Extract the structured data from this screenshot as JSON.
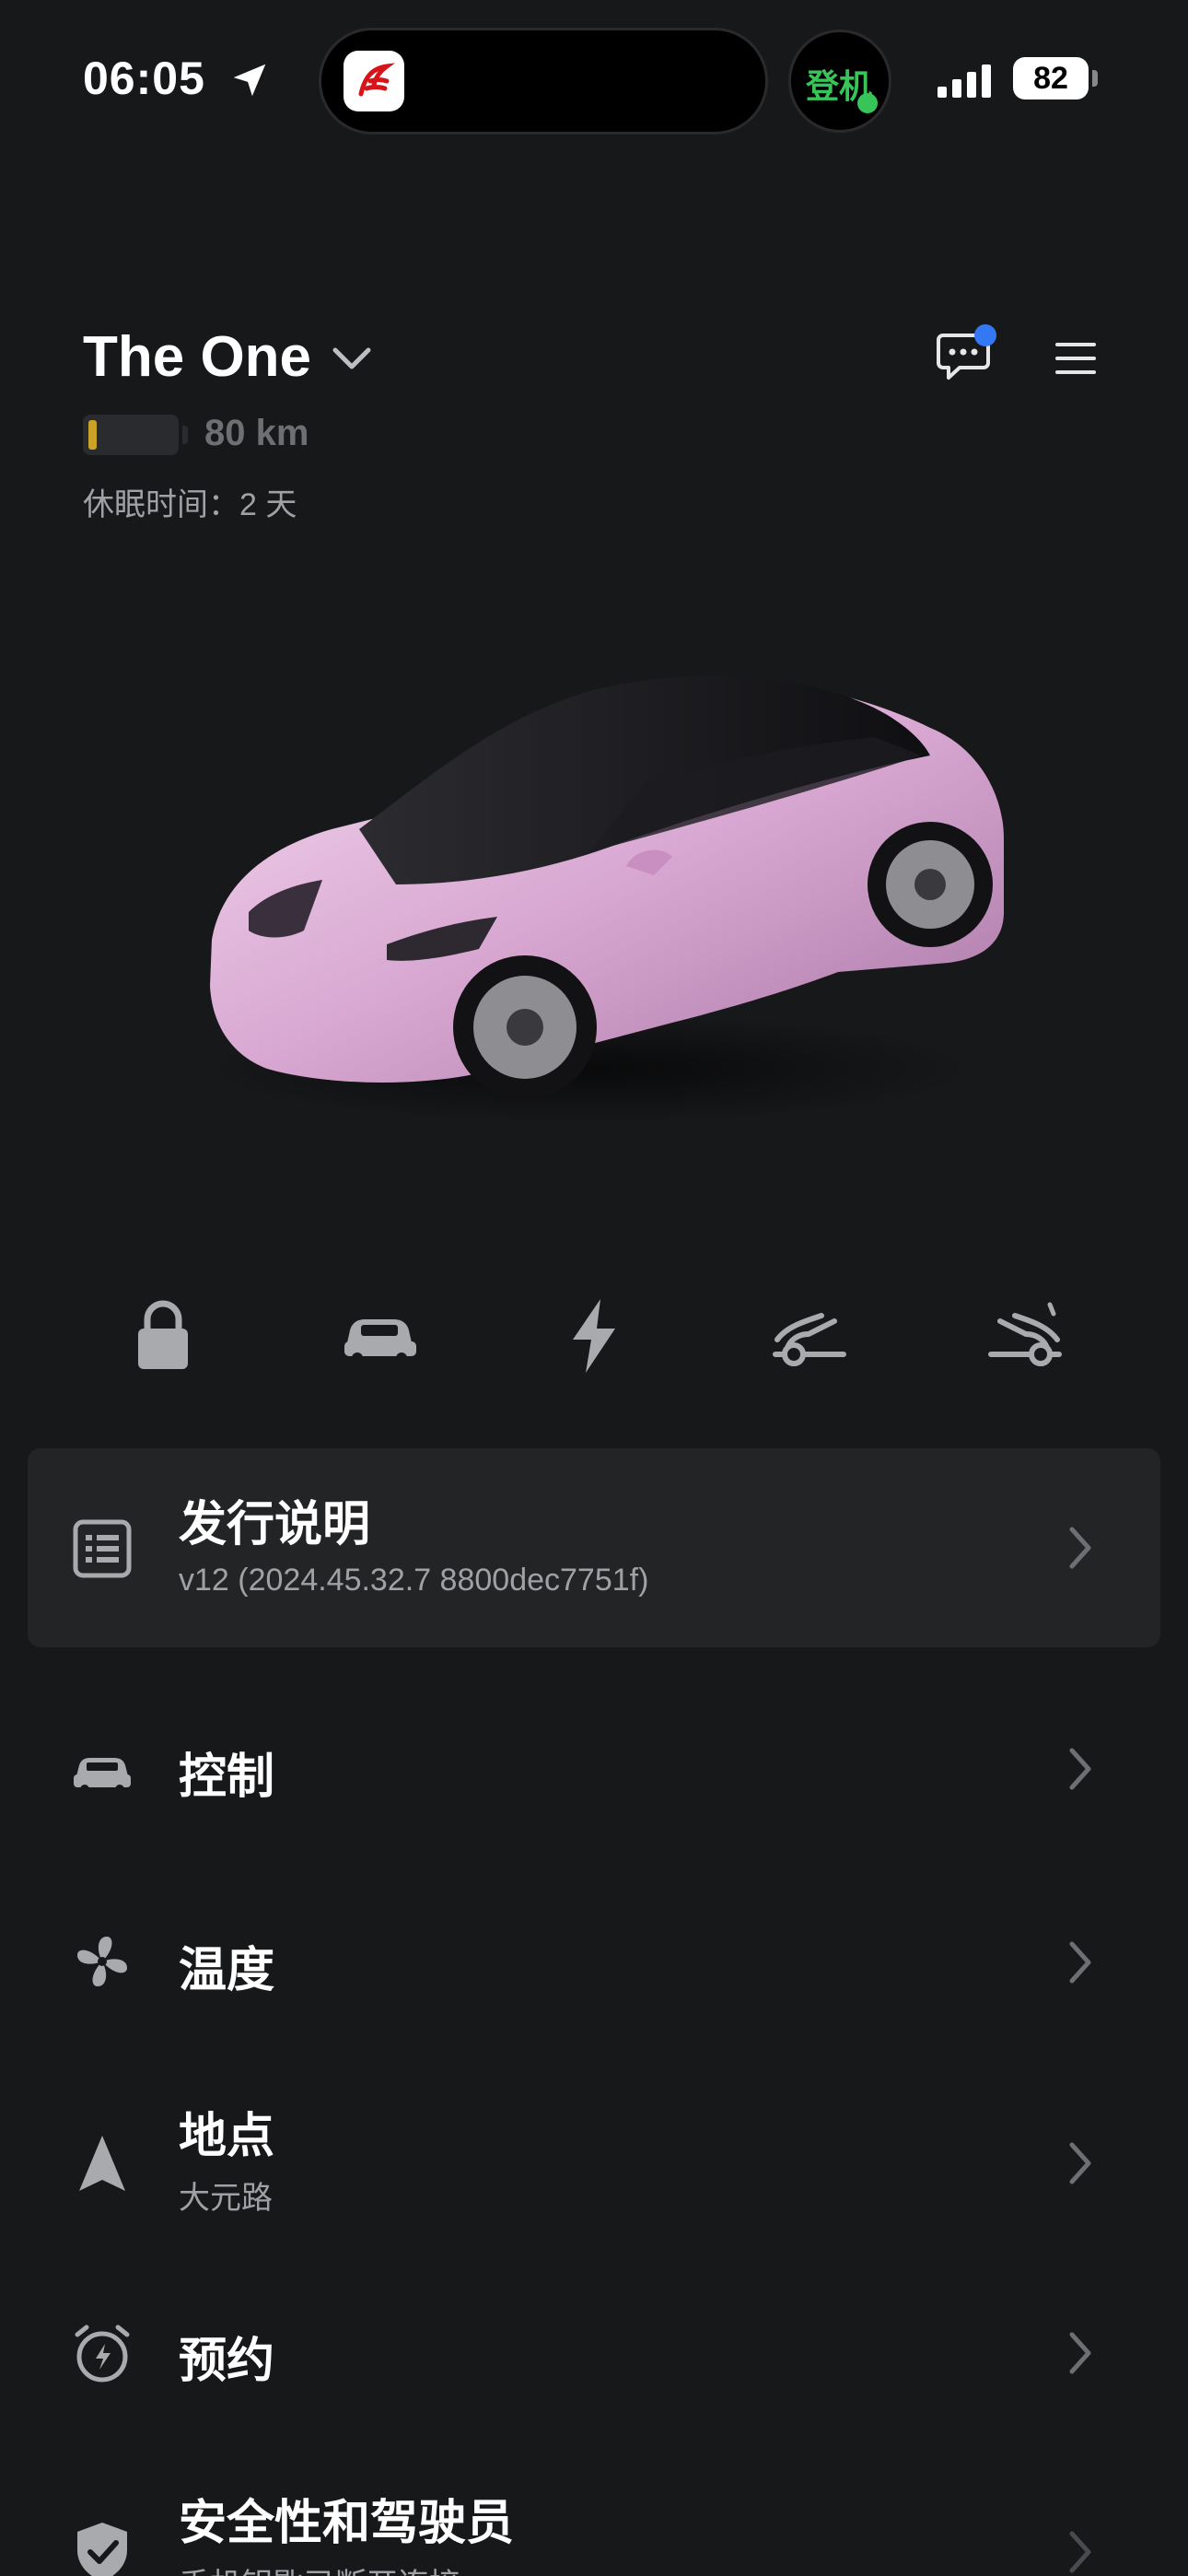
{
  "status_bar": {
    "time": "06:05",
    "boarding_label": "登机",
    "battery_percent": "82"
  },
  "header": {
    "vehicle_name": "The One",
    "range": "80 km",
    "sleep_time": "休眠时间：2 天",
    "battery_fill_fraction": 0.1
  },
  "quick_actions": [
    {
      "icon": "lock-icon"
    },
    {
      "icon": "car-front-icon"
    },
    {
      "icon": "bolt-icon"
    },
    {
      "icon": "frunk-icon"
    },
    {
      "icon": "trunk-icon"
    }
  ],
  "release_notes": {
    "title": "发行说明",
    "version": "v12 (2024.45.32.7 8800dec7751f)"
  },
  "menu": {
    "controls": {
      "title": "控制"
    },
    "climate": {
      "title": "温度"
    },
    "location": {
      "title": "地点",
      "subtitle": "大元路"
    },
    "schedule": {
      "title": "预约"
    },
    "security": {
      "title": "安全性和驾驶员",
      "subtitle": "手机钥匙已断开连接"
    }
  },
  "colors": {
    "background": "#17181a",
    "card": "#232426",
    "accent_blue": "#3478f6",
    "battery_low": "#c9a227",
    "boarding_green": "#37c559"
  }
}
